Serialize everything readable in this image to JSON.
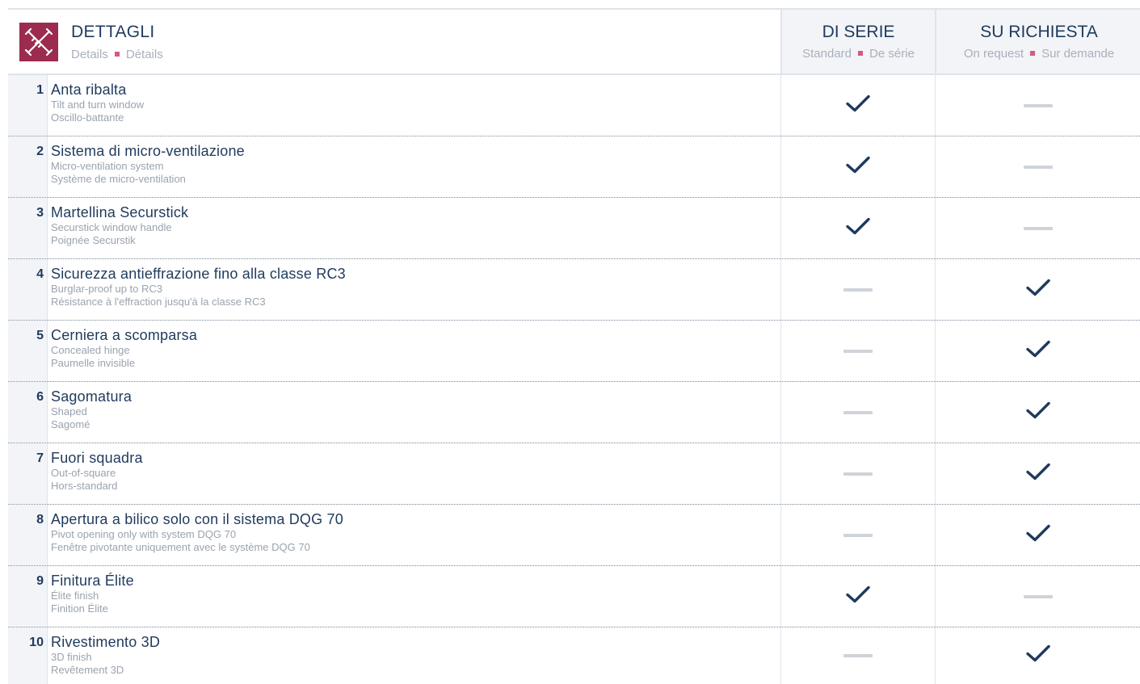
{
  "header": {
    "title": "DETTAGLI",
    "sub_en": "Details",
    "sub_fr": "Détails",
    "logo_icon": "pencil-ruler-icon",
    "columns": [
      {
        "title": "DI SERIE",
        "sub_en": "Standard",
        "sub_fr": "De série"
      },
      {
        "title": "SU RICHIESTA",
        "sub_en": "On request",
        "sub_fr": "Sur demande"
      }
    ]
  },
  "colors": {
    "navy": "#1f3a5c",
    "accent": "#9b2b4f",
    "separator": "#d45b7d",
    "muted": "#a9b0bb"
  },
  "rows": [
    {
      "num": "1",
      "it": "Anta ribalta",
      "en": "Tilt and turn window",
      "fr": "Oscillo-battante",
      "standard": true,
      "request": false
    },
    {
      "num": "2",
      "it": "Sistema di micro-ventilazione",
      "en": "Micro-ventilation system",
      "fr": "Système de micro-ventilation",
      "standard": true,
      "request": false
    },
    {
      "num": "3",
      "it": "Martellina Securstick",
      "en": "Securstick window handle",
      "fr": "Poignée Securstik",
      "standard": true,
      "request": false
    },
    {
      "num": "4",
      "it": "Sicurezza antieffrazione fino alla classe RC3",
      "en": "Burglar-proof up to RC3",
      "fr": "Résistance à l'effraction jusqu'à la classe RC3",
      "standard": false,
      "request": true
    },
    {
      "num": "5",
      "it": "Cerniera a scomparsa",
      "en": "Concealed hinge",
      "fr": "Paumelle invisible",
      "standard": false,
      "request": true
    },
    {
      "num": "6",
      "it": "Sagomatura",
      "en": "Shaped",
      "fr": "Sagomé",
      "standard": false,
      "request": true
    },
    {
      "num": "7",
      "it": "Fuori squadra",
      "en": "Out-of-square",
      "fr": "Hors-standard",
      "standard": false,
      "request": true
    },
    {
      "num": "8",
      "it": "Apertura a bilico solo con il sistema DQG 70",
      "en": "Pivot opening only with system DQG 70",
      "fr": "Fenêtre pivotante uniquement avec le système DQG 70",
      "standard": false,
      "request": true
    },
    {
      "num": "9",
      "it": "Finitura Élite",
      "en": "Élite finish",
      "fr": "Finition Élite",
      "standard": true,
      "request": false
    },
    {
      "num": "10",
      "it": "Rivestimento 3D",
      "en": "3D finish",
      "fr": "Revêtement 3D",
      "standard": false,
      "request": true
    }
  ]
}
